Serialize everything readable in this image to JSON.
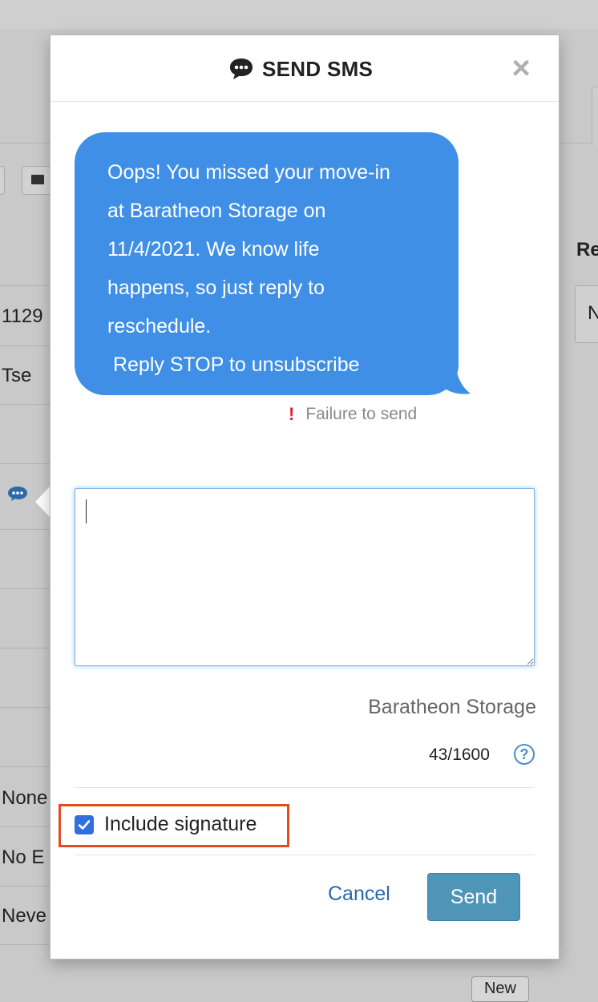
{
  "background": {
    "rows": [
      "1129",
      "Tse",
      "None",
      "No E",
      "Neve"
    ],
    "right_heading": "Re",
    "right_select": "N",
    "new_button": "New"
  },
  "modal": {
    "title": "SEND SMS",
    "close_label": "×",
    "message": "Oops! You missed your move-in\nat Baratheon Storage on\n11/4/2021. We know life\nhappens, so just reply to\nreschedule.\n Reply STOP to unsubscribe",
    "failure_text": "Failure to send",
    "failure_icon": "!",
    "input_value": "",
    "signature": "Baratheon Storage",
    "char_count": "43/1600",
    "help_label": "?",
    "include_signature_label": "Include signature",
    "include_signature_checked": true,
    "cancel_label": "Cancel",
    "send_label": "Send"
  },
  "colors": {
    "bubble": "#3f8fe6",
    "send_button": "#4f95b7",
    "link": "#2a6aa8",
    "highlight": "#e44b1f",
    "error": "#d9222a"
  },
  "icons": {
    "title": "speech-bubble-icon",
    "close": "close-icon",
    "failure": "exclamation-icon",
    "help": "question-circle-icon",
    "checkbox": "checkmark-icon"
  }
}
